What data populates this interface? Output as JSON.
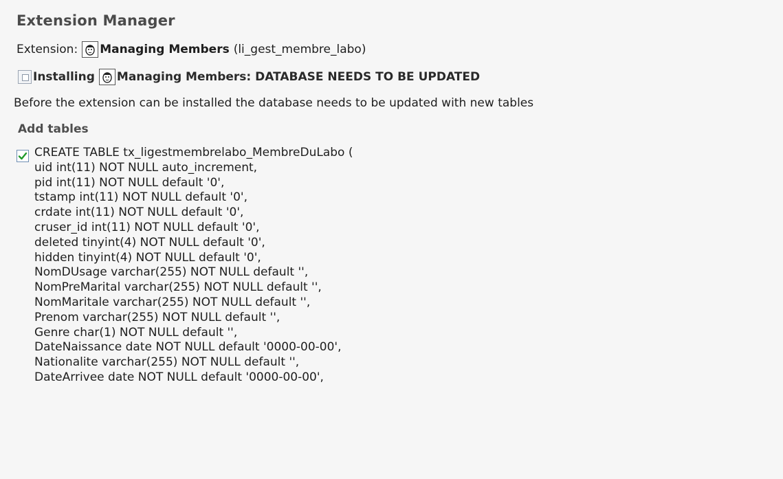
{
  "header": {
    "title": "Extension Manager"
  },
  "extension": {
    "prefix": "Extension:",
    "name": "Managing Members",
    "key": "(li_gest_membre_labo)"
  },
  "install": {
    "installing_label": "Installing",
    "status": "Managing Members: DATABASE NEEDS TO BE UPDATED"
  },
  "message": "Before the extension can be installed the database needs to be updated with new tables",
  "section": {
    "title": "Add tables"
  },
  "sql": {
    "checked": true,
    "lines": [
      "CREATE TABLE tx_ligestmembrelabo_MembreDuLabo (",
      "uid int(11) NOT NULL auto_increment,",
      "pid int(11) NOT NULL default '0',",
      "tstamp int(11) NOT NULL default '0',",
      "crdate int(11) NOT NULL default '0',",
      "cruser_id int(11) NOT NULL default '0',",
      "deleted tinyint(4) NOT NULL default '0',",
      "hidden tinyint(4) NOT NULL default '0',",
      "NomDUsage varchar(255) NOT NULL default '',",
      "NomPreMarital varchar(255) NOT NULL default '',",
      "NomMaritale varchar(255) NOT NULL default '',",
      "Prenom varchar(255) NOT NULL default '',",
      "Genre char(1) NOT NULL default '',",
      "DateNaissance date NOT NULL default '0000-00-00',",
      "Nationalite varchar(255) NOT NULL default '',",
      "DateArrivee date NOT NULL default '0000-00-00',"
    ]
  },
  "icons": {
    "extension": "extension-avatar-icon",
    "installing": "install-status-icon",
    "checkbox": "checkmark-icon"
  },
  "colors": {
    "check": "#1f9a2a",
    "checkbox_border": "#6f8fb3"
  }
}
